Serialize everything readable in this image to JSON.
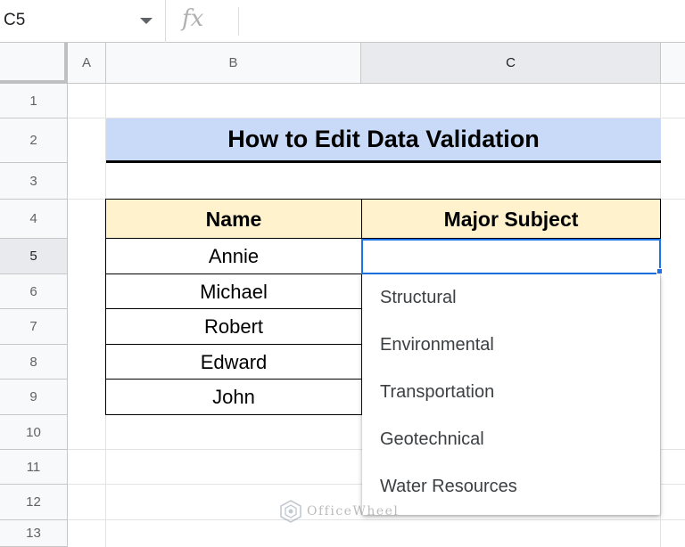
{
  "formula_bar": {
    "name_box": "C5",
    "fx_label": "fx"
  },
  "columns": [
    "A",
    "B",
    "C"
  ],
  "active_column": "C",
  "rows": [
    "1",
    "2",
    "3",
    "4",
    "5",
    "6",
    "7",
    "8",
    "9",
    "10",
    "11",
    "12",
    "13"
  ],
  "active_row": "5",
  "sheet": {
    "title": "How to Edit Data Validation",
    "headers": [
      "Name",
      "Major Subject"
    ],
    "names": [
      "Annie",
      "Michael",
      "Robert",
      "Edward",
      "John"
    ]
  },
  "dropdown": {
    "options": [
      "Structural",
      "Environmental",
      "Transportation",
      "Geotechnical",
      "Water Resources"
    ]
  },
  "watermark": "OfficeWheel",
  "colors": {
    "title_fill": "#c9daf8",
    "header_fill": "#fff2cc",
    "selection": "#1a73e8"
  }
}
